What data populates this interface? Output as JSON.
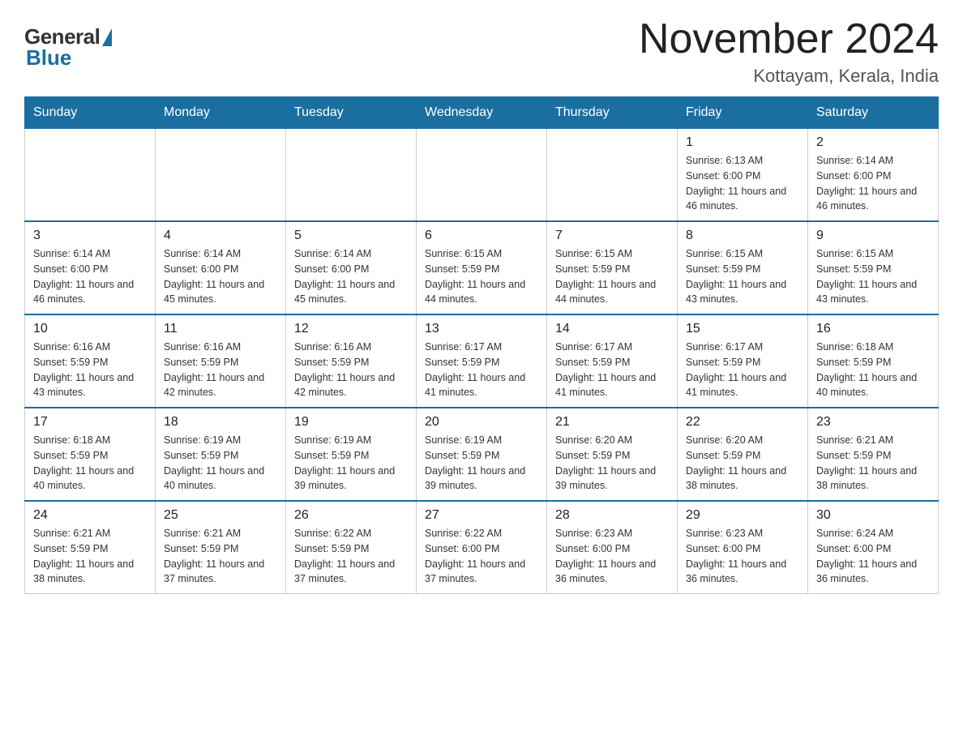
{
  "logo": {
    "general": "General",
    "blue": "Blue"
  },
  "header": {
    "title": "November 2024",
    "subtitle": "Kottayam, Kerala, India"
  },
  "weekdays": [
    "Sunday",
    "Monday",
    "Tuesday",
    "Wednesday",
    "Thursday",
    "Friday",
    "Saturday"
  ],
  "weeks": [
    [
      {
        "day": "",
        "info": ""
      },
      {
        "day": "",
        "info": ""
      },
      {
        "day": "",
        "info": ""
      },
      {
        "day": "",
        "info": ""
      },
      {
        "day": "",
        "info": ""
      },
      {
        "day": "1",
        "info": "Sunrise: 6:13 AM\nSunset: 6:00 PM\nDaylight: 11 hours and 46 minutes."
      },
      {
        "day": "2",
        "info": "Sunrise: 6:14 AM\nSunset: 6:00 PM\nDaylight: 11 hours and 46 minutes."
      }
    ],
    [
      {
        "day": "3",
        "info": "Sunrise: 6:14 AM\nSunset: 6:00 PM\nDaylight: 11 hours and 46 minutes."
      },
      {
        "day": "4",
        "info": "Sunrise: 6:14 AM\nSunset: 6:00 PM\nDaylight: 11 hours and 45 minutes."
      },
      {
        "day": "5",
        "info": "Sunrise: 6:14 AM\nSunset: 6:00 PM\nDaylight: 11 hours and 45 minutes."
      },
      {
        "day": "6",
        "info": "Sunrise: 6:15 AM\nSunset: 5:59 PM\nDaylight: 11 hours and 44 minutes."
      },
      {
        "day": "7",
        "info": "Sunrise: 6:15 AM\nSunset: 5:59 PM\nDaylight: 11 hours and 44 minutes."
      },
      {
        "day": "8",
        "info": "Sunrise: 6:15 AM\nSunset: 5:59 PM\nDaylight: 11 hours and 43 minutes."
      },
      {
        "day": "9",
        "info": "Sunrise: 6:15 AM\nSunset: 5:59 PM\nDaylight: 11 hours and 43 minutes."
      }
    ],
    [
      {
        "day": "10",
        "info": "Sunrise: 6:16 AM\nSunset: 5:59 PM\nDaylight: 11 hours and 43 minutes."
      },
      {
        "day": "11",
        "info": "Sunrise: 6:16 AM\nSunset: 5:59 PM\nDaylight: 11 hours and 42 minutes."
      },
      {
        "day": "12",
        "info": "Sunrise: 6:16 AM\nSunset: 5:59 PM\nDaylight: 11 hours and 42 minutes."
      },
      {
        "day": "13",
        "info": "Sunrise: 6:17 AM\nSunset: 5:59 PM\nDaylight: 11 hours and 41 minutes."
      },
      {
        "day": "14",
        "info": "Sunrise: 6:17 AM\nSunset: 5:59 PM\nDaylight: 11 hours and 41 minutes."
      },
      {
        "day": "15",
        "info": "Sunrise: 6:17 AM\nSunset: 5:59 PM\nDaylight: 11 hours and 41 minutes."
      },
      {
        "day": "16",
        "info": "Sunrise: 6:18 AM\nSunset: 5:59 PM\nDaylight: 11 hours and 40 minutes."
      }
    ],
    [
      {
        "day": "17",
        "info": "Sunrise: 6:18 AM\nSunset: 5:59 PM\nDaylight: 11 hours and 40 minutes."
      },
      {
        "day": "18",
        "info": "Sunrise: 6:19 AM\nSunset: 5:59 PM\nDaylight: 11 hours and 40 minutes."
      },
      {
        "day": "19",
        "info": "Sunrise: 6:19 AM\nSunset: 5:59 PM\nDaylight: 11 hours and 39 minutes."
      },
      {
        "day": "20",
        "info": "Sunrise: 6:19 AM\nSunset: 5:59 PM\nDaylight: 11 hours and 39 minutes."
      },
      {
        "day": "21",
        "info": "Sunrise: 6:20 AM\nSunset: 5:59 PM\nDaylight: 11 hours and 39 minutes."
      },
      {
        "day": "22",
        "info": "Sunrise: 6:20 AM\nSunset: 5:59 PM\nDaylight: 11 hours and 38 minutes."
      },
      {
        "day": "23",
        "info": "Sunrise: 6:21 AM\nSunset: 5:59 PM\nDaylight: 11 hours and 38 minutes."
      }
    ],
    [
      {
        "day": "24",
        "info": "Sunrise: 6:21 AM\nSunset: 5:59 PM\nDaylight: 11 hours and 38 minutes."
      },
      {
        "day": "25",
        "info": "Sunrise: 6:21 AM\nSunset: 5:59 PM\nDaylight: 11 hours and 37 minutes."
      },
      {
        "day": "26",
        "info": "Sunrise: 6:22 AM\nSunset: 5:59 PM\nDaylight: 11 hours and 37 minutes."
      },
      {
        "day": "27",
        "info": "Sunrise: 6:22 AM\nSunset: 6:00 PM\nDaylight: 11 hours and 37 minutes."
      },
      {
        "day": "28",
        "info": "Sunrise: 6:23 AM\nSunset: 6:00 PM\nDaylight: 11 hours and 36 minutes."
      },
      {
        "day": "29",
        "info": "Sunrise: 6:23 AM\nSunset: 6:00 PM\nDaylight: 11 hours and 36 minutes."
      },
      {
        "day": "30",
        "info": "Sunrise: 6:24 AM\nSunset: 6:00 PM\nDaylight: 11 hours and 36 minutes."
      }
    ]
  ]
}
